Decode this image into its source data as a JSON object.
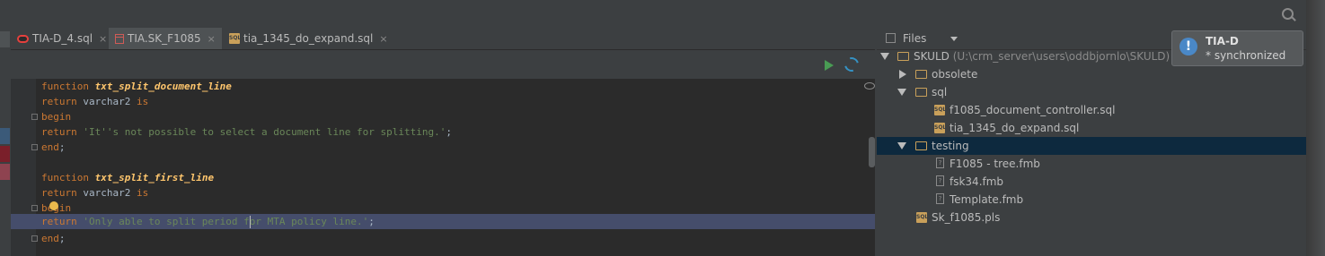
{
  "window": {
    "search_icon": "search-icon"
  },
  "tabs": [
    {
      "label": "TIA-D_4.sql",
      "close": "×",
      "icon": "oracle-db-icon"
    },
    {
      "label": "TIA.SK_F1085",
      "close": "×",
      "icon": "package-icon"
    },
    {
      "label": "tia_1345_do_expand.sql",
      "close": "×",
      "icon": "sql-file-icon",
      "icon_text": "SQL"
    }
  ],
  "editor": {
    "lines": [
      {
        "kw1": "function ",
        "name": "txt_split_document_line"
      },
      {
        "kw1": "return ",
        "text": "varchar2 ",
        "kw2": "is"
      },
      {
        "kw1": "begin"
      },
      {
        "kw1": "return ",
        "str": "'It''s not possible to select a document line for splitting.'",
        "text": ";"
      },
      {
        "kw1": "end",
        "text": ";"
      },
      {
        "kw1": ""
      },
      {
        "kw1": "function ",
        "name": "txt_split_first_line"
      },
      {
        "kw1": "return ",
        "text": "varchar2 ",
        "kw2": "is"
      },
      {
        "kw1": "begin"
      },
      {
        "kw1": "return ",
        "str": "'Only able to split period for MTA policy line.'",
        "text": ";"
      },
      {
        "kw1": "end",
        "text": ";"
      }
    ]
  },
  "files_panel": {
    "title": "Files",
    "tree": [
      {
        "name": "SKULD",
        "path": "(U:\\crm_server\\users\\oddbjornlo\\SKULD)",
        "type": "folder",
        "expanded": true
      },
      {
        "name": "obsolete",
        "type": "folder",
        "expanded": false
      },
      {
        "name": "sql",
        "type": "folder",
        "expanded": true
      },
      {
        "name": "f1085_document_controller.sql",
        "type": "sql"
      },
      {
        "name": "tia_1345_do_expand.sql",
        "type": "sql"
      },
      {
        "name": "testing",
        "type": "folder",
        "expanded": true,
        "selected": true
      },
      {
        "name": "F1085 - tree.fmb",
        "type": "unknown"
      },
      {
        "name": "fsk34.fmb",
        "type": "unknown"
      },
      {
        "name": "Template.fmb",
        "type": "unknown"
      },
      {
        "name": "Sk_f1085.pls",
        "type": "sql"
      }
    ]
  },
  "notification": {
    "title": "TIA-D",
    "message": "* synchronized",
    "icon": "!"
  },
  "colors": {
    "keyword": "#cc7832",
    "function_name": "#ffc66d",
    "string": "#6a8759",
    "selection": "#0d293e",
    "current_line": "#454d6b"
  }
}
